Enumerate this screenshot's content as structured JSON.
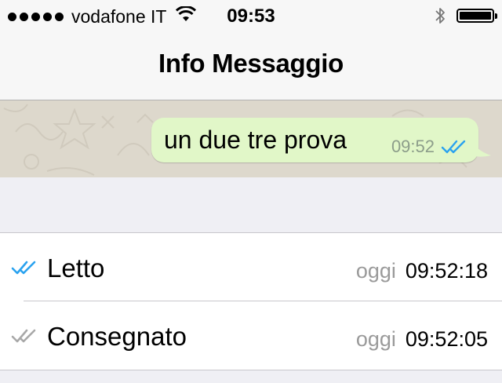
{
  "status_bar": {
    "carrier": "vodafone IT",
    "time": "09:53",
    "battery_level": 1.0
  },
  "nav": {
    "title": "Info Messaggio"
  },
  "message": {
    "text": "un due tre prova",
    "time": "09:52",
    "status_icon": "double-check-blue"
  },
  "receipts": [
    {
      "label": "Letto",
      "day": "oggi",
      "time": "09:52:18",
      "icon": "double-check-blue",
      "color": "#2aa2ef"
    },
    {
      "label": "Consegnato",
      "day": "oggi",
      "time": "09:52:05",
      "icon": "double-check-gray",
      "color": "#a8a8a8"
    }
  ],
  "colors": {
    "bubble": "#e1f7c8",
    "read_check": "#2aa2ef",
    "delivered_check": "#a8a8a8",
    "background": "#efeff4"
  }
}
